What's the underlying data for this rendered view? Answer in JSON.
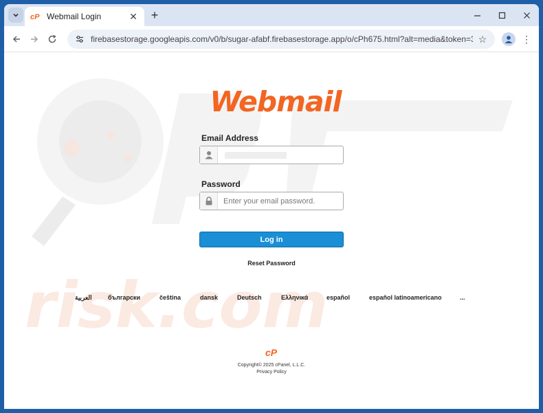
{
  "browser": {
    "tab_title": "Webmail Login",
    "new_tab_label": "+",
    "url": "firebasestorage.googleapis.com/v0/b/sugar-afabf.firebasestorage.app/o/cPh675.html?alt=media&token=335b61ad-1cf9-4..."
  },
  "page": {
    "logo_text": "Webmail",
    "email_label": "Email Address",
    "email_value": "",
    "password_label": "Password",
    "password_placeholder": "Enter your email password.",
    "login_button": "Log in",
    "reset_link": "Reset Password",
    "languages": [
      "العربية",
      "български",
      "čeština",
      "dansk",
      "Deutsch",
      "Ελληνικά",
      "español",
      "español latinoamericano",
      "..."
    ],
    "copyright": "Copyright© 2025 cPanel, L.L.C.",
    "privacy_link": "Privacy Policy",
    "brand_color": "#f26522",
    "button_color": "#1a8fd6"
  },
  "watermark": {
    "text": "risk.com"
  }
}
